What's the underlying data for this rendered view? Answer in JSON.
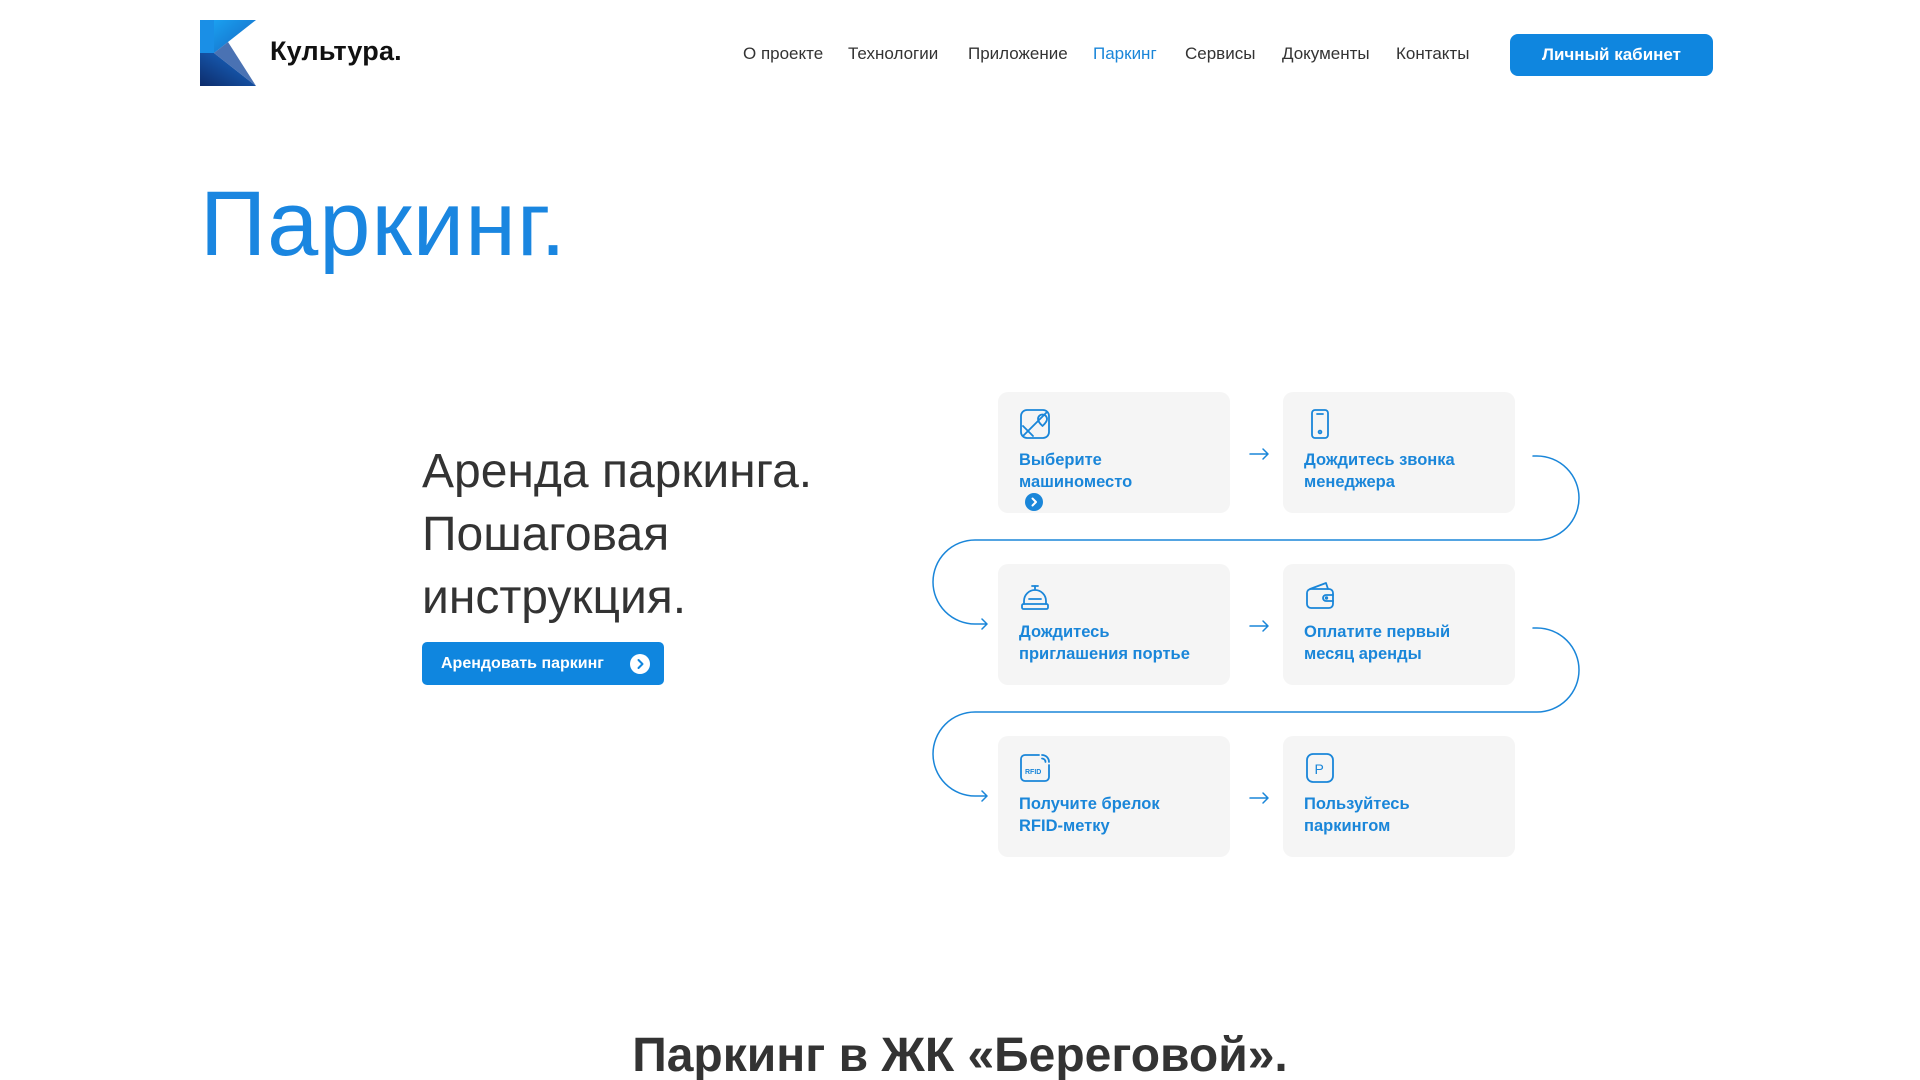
{
  "brand": {
    "name": "Культура.",
    "colors": {
      "accent": "#1a86d9",
      "button": "#0f86df",
      "card_bg": "#f5f5f5"
    }
  },
  "nav": {
    "items": [
      {
        "label": "О проекте"
      },
      {
        "label": "Технологии"
      },
      {
        "label": "Приложение"
      },
      {
        "label": "Паркинг",
        "active": true
      },
      {
        "label": "Сервисы"
      },
      {
        "label": "Документы"
      },
      {
        "label": "Контакты"
      }
    ],
    "cabinet_label": "Личный кабинет"
  },
  "page": {
    "title": "Паркинг."
  },
  "intro": {
    "lines": [
      "Аренда паркинга.",
      "Пошаговая",
      "инструкция."
    ],
    "button_label": "Арендовать паркинг"
  },
  "steps": [
    {
      "icon": "map-pin-icon",
      "lines": [
        "Выберите",
        "машиноместо"
      ]
    },
    {
      "icon": "phone-icon",
      "lines": [
        "Дождитесь звонка",
        "менеджера"
      ]
    },
    {
      "icon": "bell-icon",
      "lines": [
        "Дождитесь",
        "приглашения портье"
      ]
    },
    {
      "icon": "wallet-icon",
      "lines": [
        "Оплатите первый",
        "месяц аренды"
      ]
    },
    {
      "icon": "rfid-icon",
      "icon_text": "RFID",
      "lines": [
        "Получите брелок",
        "RFID-метку"
      ]
    },
    {
      "icon": "parking-icon",
      "icon_text": "P",
      "lines": [
        "Пользуйтесь",
        "паркингом"
      ]
    }
  ],
  "section": {
    "title": "Паркинг в ЖК «Береговой»."
  }
}
